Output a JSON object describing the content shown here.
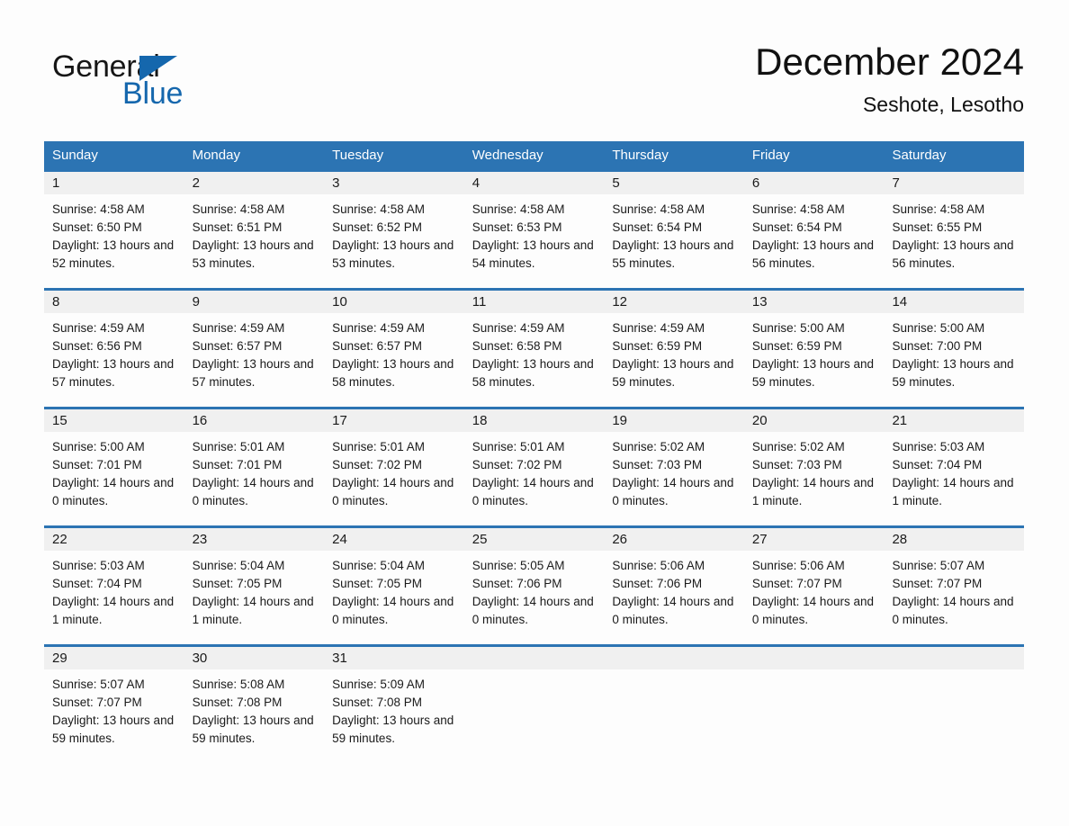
{
  "brand": {
    "line1": "General",
    "line2": "Blue",
    "triangle_color": "#1567ad"
  },
  "header": {
    "title": "December 2024",
    "subtitle": "Seshote, Lesotho"
  },
  "theme": {
    "header_blue": "#2c74b3",
    "date_band_gray": "#f0f0f0",
    "page_background": "#fdfdfd",
    "text_color": "#1a1a1a"
  },
  "weekdays": [
    "Sunday",
    "Monday",
    "Tuesday",
    "Wednesday",
    "Thursday",
    "Friday",
    "Saturday"
  ],
  "weeks": [
    [
      {
        "day": "1",
        "sunrise": "Sunrise: 4:58 AM",
        "sunset": "Sunset: 6:50 PM",
        "daylight": "Daylight: 13 hours and 52 minutes."
      },
      {
        "day": "2",
        "sunrise": "Sunrise: 4:58 AM",
        "sunset": "Sunset: 6:51 PM",
        "daylight": "Daylight: 13 hours and 53 minutes."
      },
      {
        "day": "3",
        "sunrise": "Sunrise: 4:58 AM",
        "sunset": "Sunset: 6:52 PM",
        "daylight": "Daylight: 13 hours and 53 minutes."
      },
      {
        "day": "4",
        "sunrise": "Sunrise: 4:58 AM",
        "sunset": "Sunset: 6:53 PM",
        "daylight": "Daylight: 13 hours and 54 minutes."
      },
      {
        "day": "5",
        "sunrise": "Sunrise: 4:58 AM",
        "sunset": "Sunset: 6:54 PM",
        "daylight": "Daylight: 13 hours and 55 minutes."
      },
      {
        "day": "6",
        "sunrise": "Sunrise: 4:58 AM",
        "sunset": "Sunset: 6:54 PM",
        "daylight": "Daylight: 13 hours and 56 minutes."
      },
      {
        "day": "7",
        "sunrise": "Sunrise: 4:58 AM",
        "sunset": "Sunset: 6:55 PM",
        "daylight": "Daylight: 13 hours and 56 minutes."
      }
    ],
    [
      {
        "day": "8",
        "sunrise": "Sunrise: 4:59 AM",
        "sunset": "Sunset: 6:56 PM",
        "daylight": "Daylight: 13 hours and 57 minutes."
      },
      {
        "day": "9",
        "sunrise": "Sunrise: 4:59 AM",
        "sunset": "Sunset: 6:57 PM",
        "daylight": "Daylight: 13 hours and 57 minutes."
      },
      {
        "day": "10",
        "sunrise": "Sunrise: 4:59 AM",
        "sunset": "Sunset: 6:57 PM",
        "daylight": "Daylight: 13 hours and 58 minutes."
      },
      {
        "day": "11",
        "sunrise": "Sunrise: 4:59 AM",
        "sunset": "Sunset: 6:58 PM",
        "daylight": "Daylight: 13 hours and 58 minutes."
      },
      {
        "day": "12",
        "sunrise": "Sunrise: 4:59 AM",
        "sunset": "Sunset: 6:59 PM",
        "daylight": "Daylight: 13 hours and 59 minutes."
      },
      {
        "day": "13",
        "sunrise": "Sunrise: 5:00 AM",
        "sunset": "Sunset: 6:59 PM",
        "daylight": "Daylight: 13 hours and 59 minutes."
      },
      {
        "day": "14",
        "sunrise": "Sunrise: 5:00 AM",
        "sunset": "Sunset: 7:00 PM",
        "daylight": "Daylight: 13 hours and 59 minutes."
      }
    ],
    [
      {
        "day": "15",
        "sunrise": "Sunrise: 5:00 AM",
        "sunset": "Sunset: 7:01 PM",
        "daylight": "Daylight: 14 hours and 0 minutes."
      },
      {
        "day": "16",
        "sunrise": "Sunrise: 5:01 AM",
        "sunset": "Sunset: 7:01 PM",
        "daylight": "Daylight: 14 hours and 0 minutes."
      },
      {
        "day": "17",
        "sunrise": "Sunrise: 5:01 AM",
        "sunset": "Sunset: 7:02 PM",
        "daylight": "Daylight: 14 hours and 0 minutes."
      },
      {
        "day": "18",
        "sunrise": "Sunrise: 5:01 AM",
        "sunset": "Sunset: 7:02 PM",
        "daylight": "Daylight: 14 hours and 0 minutes."
      },
      {
        "day": "19",
        "sunrise": "Sunrise: 5:02 AM",
        "sunset": "Sunset: 7:03 PM",
        "daylight": "Daylight: 14 hours and 0 minutes."
      },
      {
        "day": "20",
        "sunrise": "Sunrise: 5:02 AM",
        "sunset": "Sunset: 7:03 PM",
        "daylight": "Daylight: 14 hours and 1 minute."
      },
      {
        "day": "21",
        "sunrise": "Sunrise: 5:03 AM",
        "sunset": "Sunset: 7:04 PM",
        "daylight": "Daylight: 14 hours and 1 minute."
      }
    ],
    [
      {
        "day": "22",
        "sunrise": "Sunrise: 5:03 AM",
        "sunset": "Sunset: 7:04 PM",
        "daylight": "Daylight: 14 hours and 1 minute."
      },
      {
        "day": "23",
        "sunrise": "Sunrise: 5:04 AM",
        "sunset": "Sunset: 7:05 PM",
        "daylight": "Daylight: 14 hours and 1 minute."
      },
      {
        "day": "24",
        "sunrise": "Sunrise: 5:04 AM",
        "sunset": "Sunset: 7:05 PM",
        "daylight": "Daylight: 14 hours and 0 minutes."
      },
      {
        "day": "25",
        "sunrise": "Sunrise: 5:05 AM",
        "sunset": "Sunset: 7:06 PM",
        "daylight": "Daylight: 14 hours and 0 minutes."
      },
      {
        "day": "26",
        "sunrise": "Sunrise: 5:06 AM",
        "sunset": "Sunset: 7:06 PM",
        "daylight": "Daylight: 14 hours and 0 minutes."
      },
      {
        "day": "27",
        "sunrise": "Sunrise: 5:06 AM",
        "sunset": "Sunset: 7:07 PM",
        "daylight": "Daylight: 14 hours and 0 minutes."
      },
      {
        "day": "28",
        "sunrise": "Sunrise: 5:07 AM",
        "sunset": "Sunset: 7:07 PM",
        "daylight": "Daylight: 14 hours and 0 minutes."
      }
    ],
    [
      {
        "day": "29",
        "sunrise": "Sunrise: 5:07 AM",
        "sunset": "Sunset: 7:07 PM",
        "daylight": "Daylight: 13 hours and 59 minutes."
      },
      {
        "day": "30",
        "sunrise": "Sunrise: 5:08 AM",
        "sunset": "Sunset: 7:08 PM",
        "daylight": "Daylight: 13 hours and 59 minutes."
      },
      {
        "day": "31",
        "sunrise": "Sunrise: 5:09 AM",
        "sunset": "Sunset: 7:08 PM",
        "daylight": "Daylight: 13 hours and 59 minutes."
      },
      {
        "day": "",
        "sunrise": "",
        "sunset": "",
        "daylight": ""
      },
      {
        "day": "",
        "sunrise": "",
        "sunset": "",
        "daylight": ""
      },
      {
        "day": "",
        "sunrise": "",
        "sunset": "",
        "daylight": ""
      },
      {
        "day": "",
        "sunrise": "",
        "sunset": "",
        "daylight": ""
      }
    ]
  ]
}
